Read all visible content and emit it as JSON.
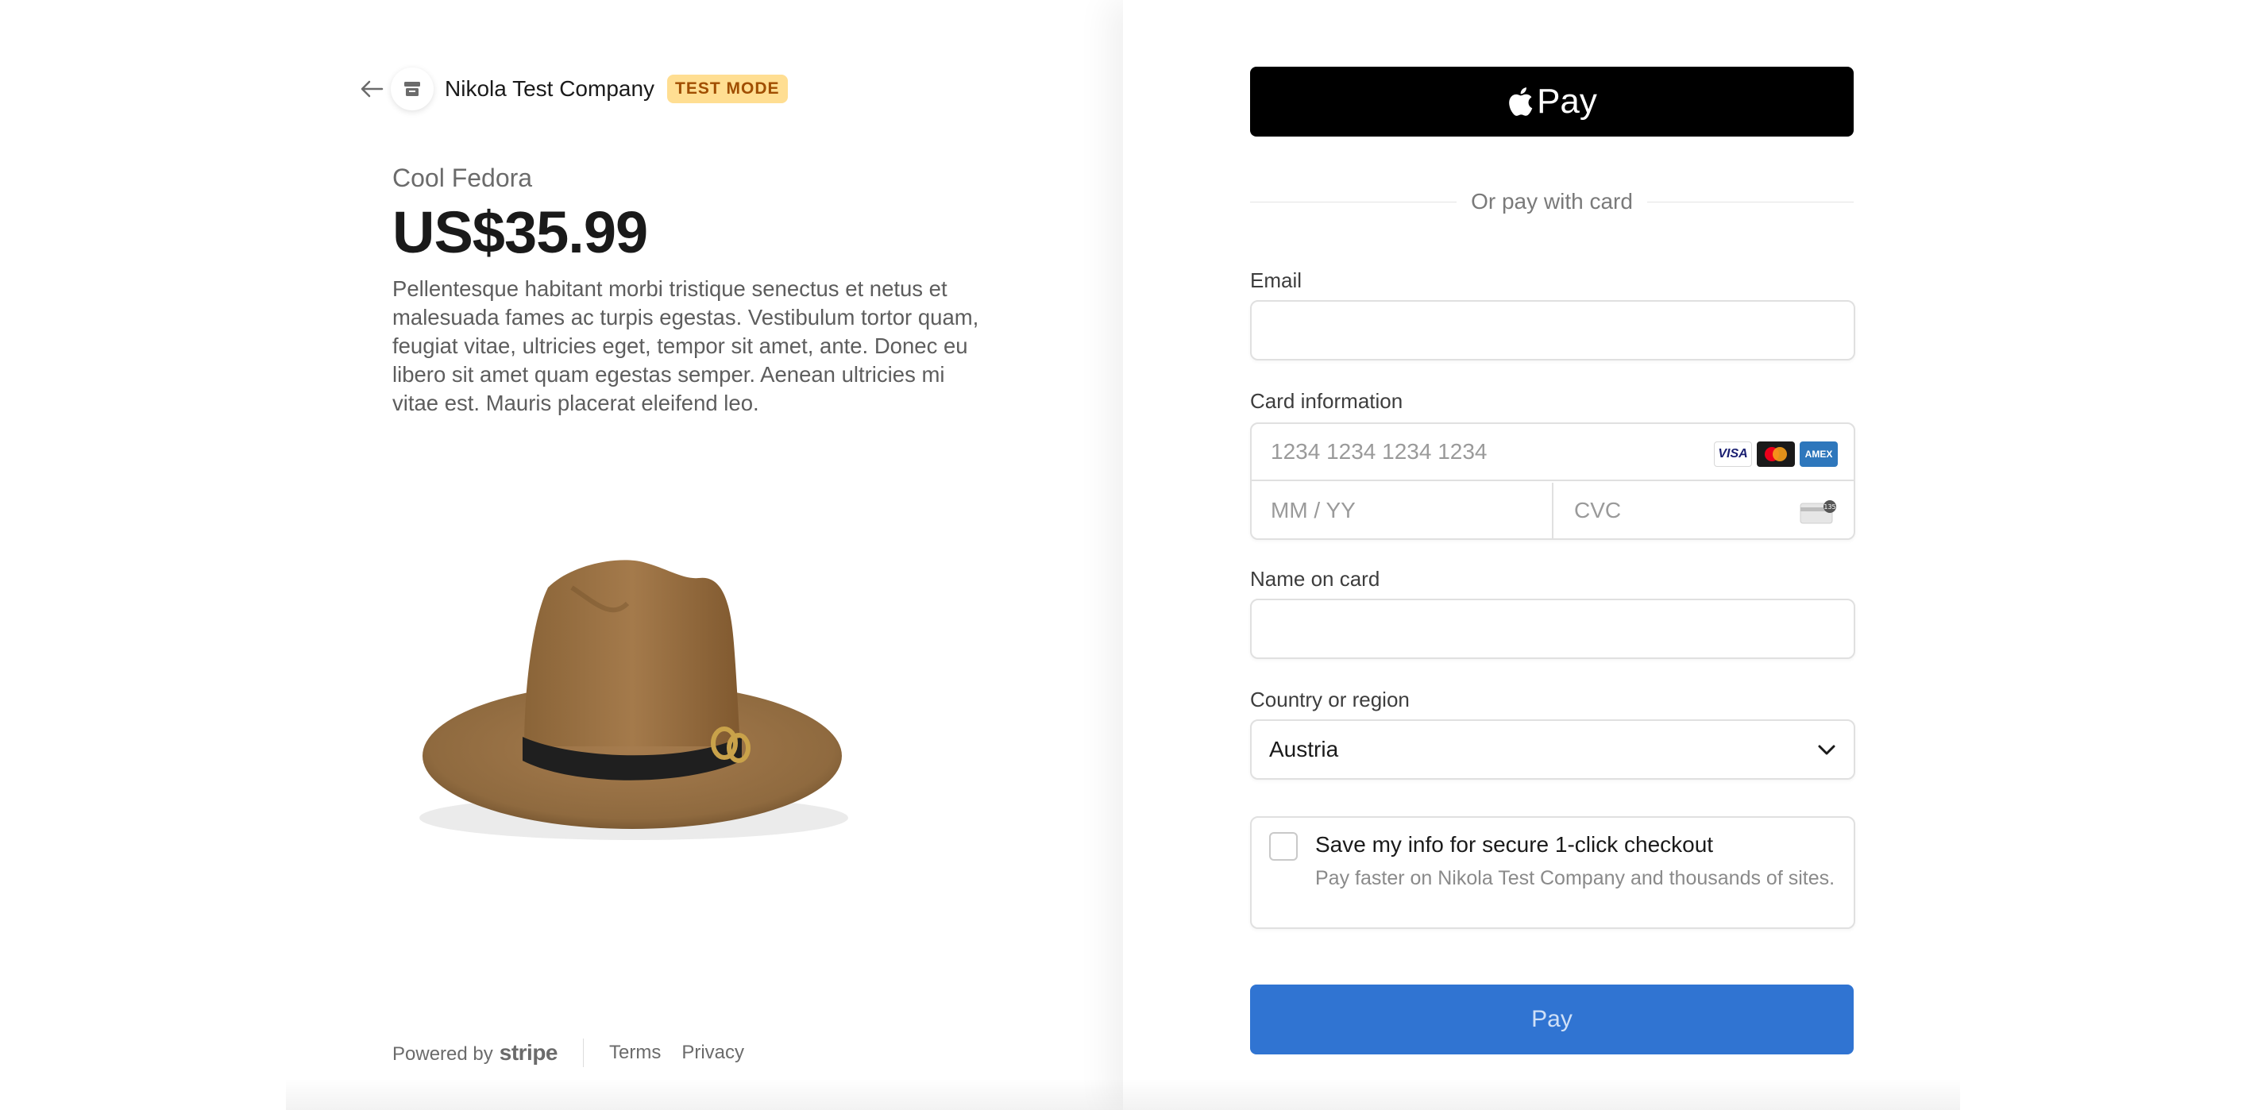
{
  "merchant": {
    "name": "Nikola Test Company",
    "badge": "TEST MODE"
  },
  "product": {
    "name": "Cool Fedora",
    "price": "US$35.99",
    "description": "Pellentesque habitant morbi tristique senectus et netus et malesuada fames ac turpis egestas. Vestibulum tortor quam, feugiat vitae, ultricies eget, tempor sit amet, ante. Donec eu libero sit amet quam egestas semper. Aenean ultricies mi vitae est. Mauris placerat eleifend leo."
  },
  "footer": {
    "powered_by": "Powered by",
    "brand": "stripe",
    "terms": "Terms",
    "privacy": "Privacy"
  },
  "checkout": {
    "apple_pay_label": "Pay",
    "divider_text": "Or pay with card",
    "email_label": "Email",
    "email_value": "",
    "card_label": "Card information",
    "card_number_placeholder": "1234 1234 1234 1234",
    "expiry_placeholder": "MM / YY",
    "cvc_placeholder": "CVC",
    "card_brands": [
      "VISA",
      "mastercard-icon",
      "AMEX"
    ],
    "name_label": "Name on card",
    "name_value": "",
    "country_label": "Country or region",
    "country_value": "Austria",
    "save_title": "Save my info for secure 1-click checkout",
    "save_subtitle": "Pay faster on Nikola Test Company and thousands of sites.",
    "pay_button": "Pay"
  },
  "colors": {
    "test_badge_bg": "#ffde92",
    "test_badge_text": "#a04e00",
    "pay_button_bg": "#3074d2",
    "apple_pay_bg": "#000000"
  }
}
